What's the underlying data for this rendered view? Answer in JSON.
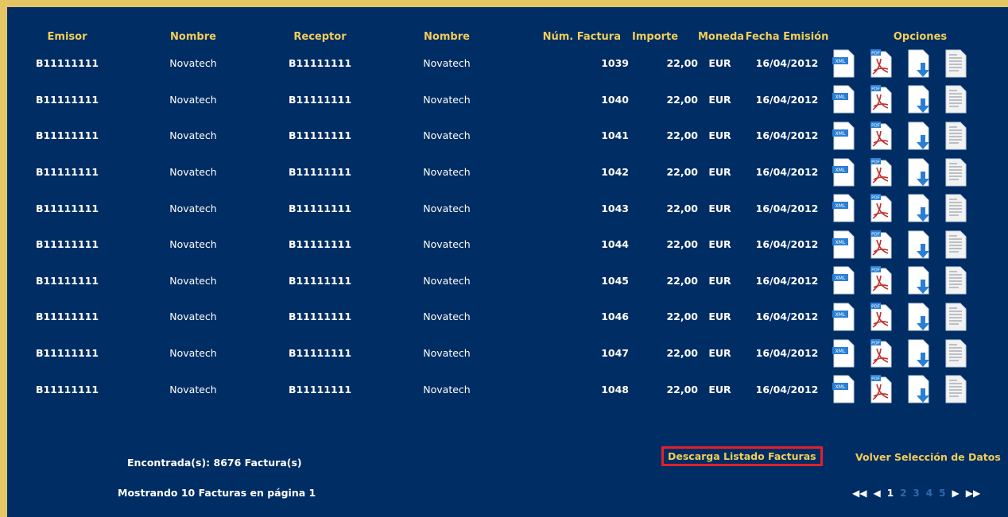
{
  "table": {
    "headers": {
      "emisor": "Emisor",
      "nombre_emisor": "Nombre",
      "receptor": "Receptor",
      "nombre_receptor": "Nombre",
      "num_factura": "Núm. Factura",
      "importe": "Importe",
      "moneda": "Moneda",
      "fecha": "Fecha Emisión",
      "opciones": "Opciones"
    },
    "rows": [
      {
        "emisor": "B11111111",
        "nombre_emisor": "Novatech",
        "receptor": "B11111111",
        "nombre_receptor": "Novatech",
        "num_factura": "1039",
        "importe": "22,00",
        "moneda": "EUR",
        "fecha": "16/04/2012"
      },
      {
        "emisor": "B11111111",
        "nombre_emisor": "Novatech",
        "receptor": "B11111111",
        "nombre_receptor": "Novatech",
        "num_factura": "1040",
        "importe": "22,00",
        "moneda": "EUR",
        "fecha": "16/04/2012"
      },
      {
        "emisor": "B11111111",
        "nombre_emisor": "Novatech",
        "receptor": "B11111111",
        "nombre_receptor": "Novatech",
        "num_factura": "1041",
        "importe": "22,00",
        "moneda": "EUR",
        "fecha": "16/04/2012"
      },
      {
        "emisor": "B11111111",
        "nombre_emisor": "Novatech",
        "receptor": "B11111111",
        "nombre_receptor": "Novatech",
        "num_factura": "1042",
        "importe": "22,00",
        "moneda": "EUR",
        "fecha": "16/04/2012"
      },
      {
        "emisor": "B11111111",
        "nombre_emisor": "Novatech",
        "receptor": "B11111111",
        "nombre_receptor": "Novatech",
        "num_factura": "1043",
        "importe": "22,00",
        "moneda": "EUR",
        "fecha": "16/04/2012"
      },
      {
        "emisor": "B11111111",
        "nombre_emisor": "Novatech",
        "receptor": "B11111111",
        "nombre_receptor": "Novatech",
        "num_factura": "1044",
        "importe": "22,00",
        "moneda": "EUR",
        "fecha": "16/04/2012"
      },
      {
        "emisor": "B11111111",
        "nombre_emisor": "Novatech",
        "receptor": "B11111111",
        "nombre_receptor": "Novatech",
        "num_factura": "1045",
        "importe": "22,00",
        "moneda": "EUR",
        "fecha": "16/04/2012"
      },
      {
        "emisor": "B11111111",
        "nombre_emisor": "Novatech",
        "receptor": "B11111111",
        "nombre_receptor": "Novatech",
        "num_factura": "1046",
        "importe": "22,00",
        "moneda": "EUR",
        "fecha": "16/04/2012"
      },
      {
        "emisor": "B11111111",
        "nombre_emisor": "Novatech",
        "receptor": "B11111111",
        "nombre_receptor": "Novatech",
        "num_factura": "1047",
        "importe": "22,00",
        "moneda": "EUR",
        "fecha": "16/04/2012"
      },
      {
        "emisor": "B11111111",
        "nombre_emisor": "Novatech",
        "receptor": "B11111111",
        "nombre_receptor": "Novatech",
        "num_factura": "1048",
        "importe": "22,00",
        "moneda": "EUR",
        "fecha": "16/04/2012"
      }
    ],
    "row_icons": [
      "xml-icon",
      "pdf-icon",
      "download-icon",
      "document-icon"
    ]
  },
  "footer": {
    "found": "Encontrada(s): 8676 Factura(s)",
    "showing": "Mostrando 10 Facturas en página 1",
    "download_list": "Descarga Listado Facturas",
    "back": "Volver Selección de Datos"
  },
  "pager": {
    "first": "◀◀",
    "prev": "◀",
    "pages": [
      "1",
      "2",
      "3",
      "4",
      "5"
    ],
    "current": "1",
    "next": "▶",
    "last": "▶▶"
  },
  "colors": {
    "background": "#002d63",
    "frame": "#e6c565",
    "header_text": "#f0cd59",
    "highlight_box": "#e2202b"
  }
}
